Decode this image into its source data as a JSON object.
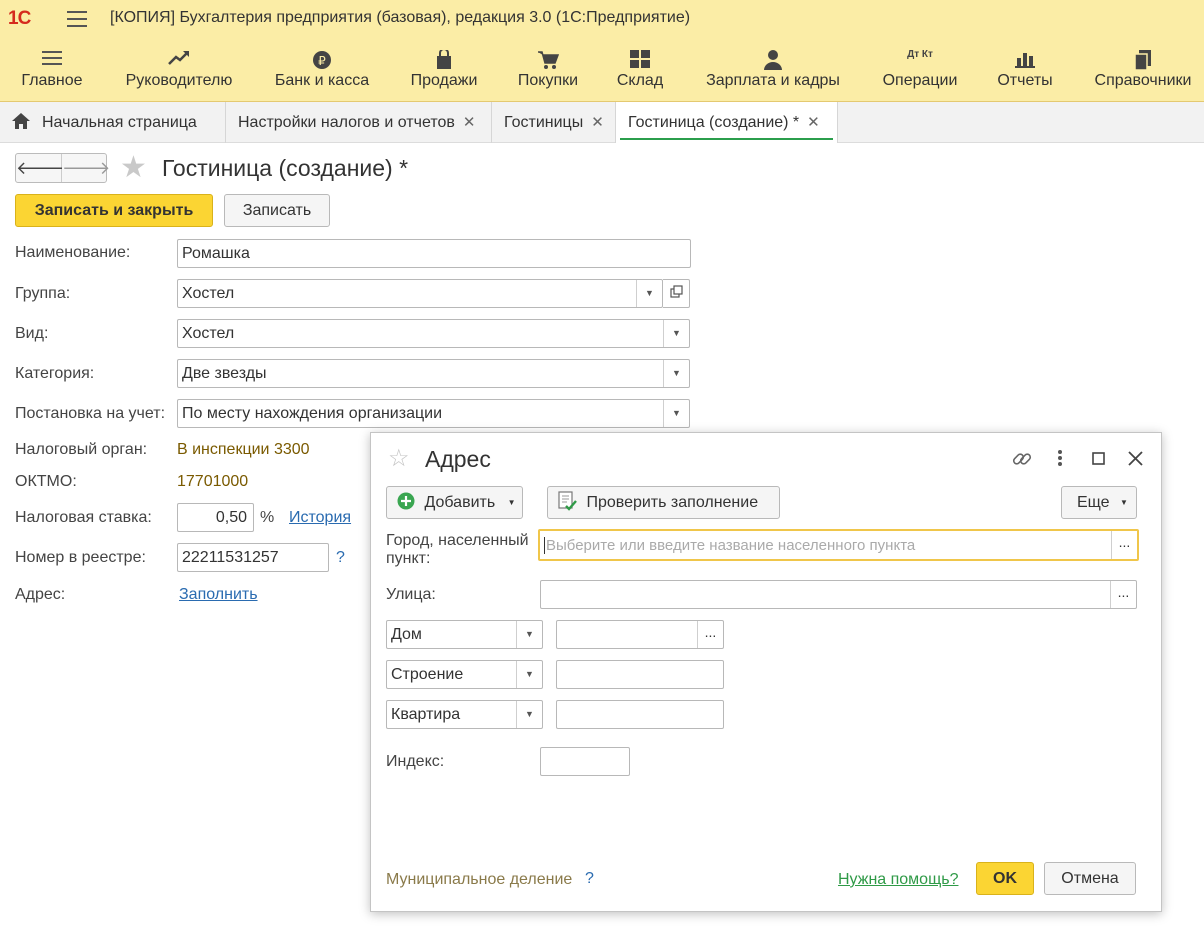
{
  "app": {
    "logo_text": "1С",
    "window_title": "[КОПИЯ] Бухгалтерия предприятия (базовая), редакция 3.0  (1С:Предприятие)"
  },
  "sections": [
    {
      "label": "Главное",
      "icon": "menu-lines-icon"
    },
    {
      "label": "Руководителю",
      "icon": "trend-up-icon"
    },
    {
      "label": "Банк и касса",
      "icon": "ruble-coin-icon"
    },
    {
      "label": "Продажи",
      "icon": "shopping-bag-icon"
    },
    {
      "label": "Покупки",
      "icon": "cart-icon"
    },
    {
      "label": "Склад",
      "icon": "warehouse-grid-icon"
    },
    {
      "label": "Зарплата и кадры",
      "icon": "person-icon"
    },
    {
      "label": "Операции",
      "icon": "dt-kt-icon",
      "icon_text": "Дт Кт"
    },
    {
      "label": "Отчеты",
      "icon": "bar-chart-icon"
    },
    {
      "label": "Справочники",
      "icon": "books-icon"
    }
  ],
  "tabs": [
    {
      "label": "Начальная страница",
      "icon": "home-icon"
    },
    {
      "label": "Настройки налогов и отчетов",
      "close": "✕"
    },
    {
      "label": "Гостиницы",
      "close": "✕"
    },
    {
      "label": "Гостиница (создание) *",
      "close": "✕",
      "active": true
    }
  ],
  "form": {
    "title": "Гостиница (создание) *",
    "save_close_label": "Записать и закрыть",
    "save_label": "Записать",
    "fields": {
      "name": {
        "label": "Наименование:",
        "value": "Ромашка"
      },
      "group": {
        "label": "Группа:",
        "value": "Хостел"
      },
      "kind": {
        "label": "Вид:",
        "value": "Хостел"
      },
      "category": {
        "label": "Категория:",
        "value": "Две звезды"
      },
      "registration": {
        "label": "Постановка на учет:",
        "value": "По месту нахождения организации"
      },
      "tax_office": {
        "label": "Налоговый орган:",
        "value": "В инспекции 3300"
      },
      "oktmo": {
        "label": "ОКТМО:",
        "value": "17701000"
      },
      "tax_rate": {
        "label": "Налоговая ставка:",
        "value": "0,50",
        "unit": "%",
        "history_link": "История"
      },
      "registry_number": {
        "label": "Номер в реестре:",
        "value": "22211531257",
        "help": "?"
      },
      "address": {
        "label": "Адрес:",
        "link": "Заполнить"
      }
    }
  },
  "dialog": {
    "title": "Адрес",
    "add_label": "Добавить",
    "check_label": "Проверить заполнение",
    "more_label": "Еще",
    "city_label": "Город, населенный пункт:",
    "city_placeholder": "Выберите или введите название населенного пункта",
    "street_label": "Улица:",
    "house_type": "Дом",
    "building_type": "Строение",
    "apartment_type": "Квартира",
    "index_label": "Индекс:",
    "municipal_label": "Муниципальное деление",
    "municipal_help": "?",
    "help_link": "Нужна помощь?",
    "ok_label": "OK",
    "cancel_label": "Отмена",
    "ellipsis": "..."
  },
  "colors": {
    "title_bar_bg": "#fbeda6",
    "primary_button": "#fbd533",
    "active_tab_underline": "#2b9e4c",
    "link": "#2a6bb0",
    "value_text": "#7a5a00",
    "field_focus_border": "#f0c64a"
  }
}
